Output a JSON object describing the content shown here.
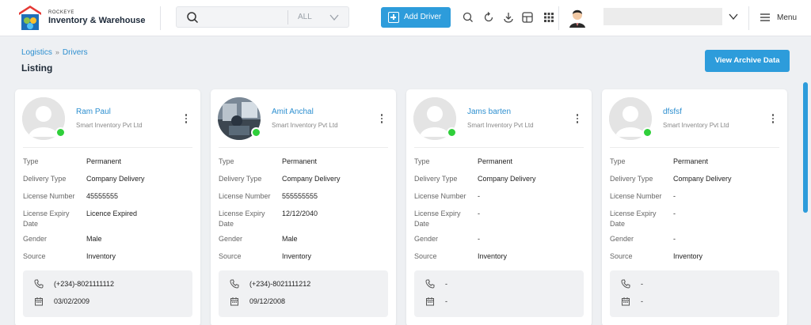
{
  "brand": {
    "small": "ROCKEYE",
    "big": "Inventory & Warehouse"
  },
  "search": {
    "scope": "ALL"
  },
  "header": {
    "add_driver": "Add Driver",
    "menu": "Menu"
  },
  "breadcrumb": {
    "first": "Logistics",
    "sep": "»",
    "second": "Drivers"
  },
  "page": {
    "title": "Listing",
    "archive": "View Archive Data"
  },
  "labels": {
    "type": "Type",
    "delivery_type": "Delivery Type",
    "license_number": "License Number",
    "license_expiry_l1": "License Expiry",
    "license_expiry_l2": "Date",
    "gender": "Gender",
    "source": "Source"
  },
  "drivers": [
    {
      "name": "Ram Paul",
      "company": "Smart Inventory Pvt Ltd",
      "type": "Permanent",
      "delivery_type": "Company Delivery",
      "license_number": "45555555",
      "license_expiry": "Licence Expired",
      "gender": "Male",
      "source": "Inventory",
      "phone": "(+234)-8021111112",
      "date": "03/02/2009",
      "status": "online"
    },
    {
      "name": "Amit Anchal",
      "company": "Smart Inventory Pvt Ltd",
      "type": "Permanent",
      "delivery_type": "Company Delivery",
      "license_number": "555555555",
      "license_expiry": "12/12/2040",
      "gender": "Male",
      "source": "Inventory",
      "phone": "(+234)-8021111212",
      "date": "09/12/2008",
      "status": "online"
    },
    {
      "name": "Jams barten",
      "company": "Smart Inventory Pvt Ltd",
      "type": "Permanent",
      "delivery_type": "Company Delivery",
      "license_number": "-",
      "license_expiry": "-",
      "gender": "-",
      "source": "Inventory",
      "phone": "-",
      "date": "-",
      "status": "online"
    },
    {
      "name": "dfsfsf",
      "company": "Smart Inventory Pvt Ltd",
      "type": "Permanent",
      "delivery_type": "Company Delivery",
      "license_number": "-",
      "license_expiry": "-",
      "gender": "-",
      "source": "Inventory",
      "phone": "-",
      "date": "-",
      "status": "online"
    }
  ],
  "colors": {
    "accent": "#2d9cdb",
    "online": "#2fcf3a",
    "link": "#2d8fd0"
  }
}
